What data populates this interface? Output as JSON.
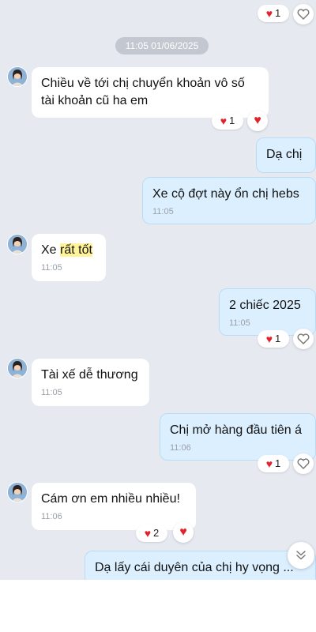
{
  "date_stamp": "11:05 01/06/2025",
  "messages": [
    {
      "text": "Chiều về tới chị chuyển khoản vô số tài khoản cũ ha em",
      "reaction_count": "1"
    },
    {
      "text": "Dạ chị"
    },
    {
      "text": "Xe cộ đợt này ổn chị hebs",
      "time": "11:05"
    },
    {
      "text_before": "Xe ",
      "text_highlight": "rất tốt",
      "time": "11:05"
    },
    {
      "text": "2 chiếc 2025",
      "time": "11:05",
      "reaction_count": "1"
    },
    {
      "text": "Tài xế dễ thương",
      "time": "11:05"
    },
    {
      "text": "Chị mở hàng đầu tiên á",
      "time": "11:06",
      "reaction_count": "1"
    },
    {
      "text": "Cám ơn em nhiều nhiều!",
      "time": "11:06",
      "reaction_count": "2"
    },
    {
      "text": "Dạ lấy cái duyên của chị hy vọng ..."
    }
  ],
  "top_reaction_count": "1",
  "icons": {
    "reaction": "heart-icon",
    "react_button": "heart-outline-icon",
    "scroll": "chevron-double-down-icon"
  },
  "colors": {
    "chat_bg": "#e6e9f0",
    "outgoing_bubble": "#dcefff",
    "incoming_bubble": "#ffffff",
    "heart": "#e0242e",
    "highlight": "#fff39a"
  }
}
